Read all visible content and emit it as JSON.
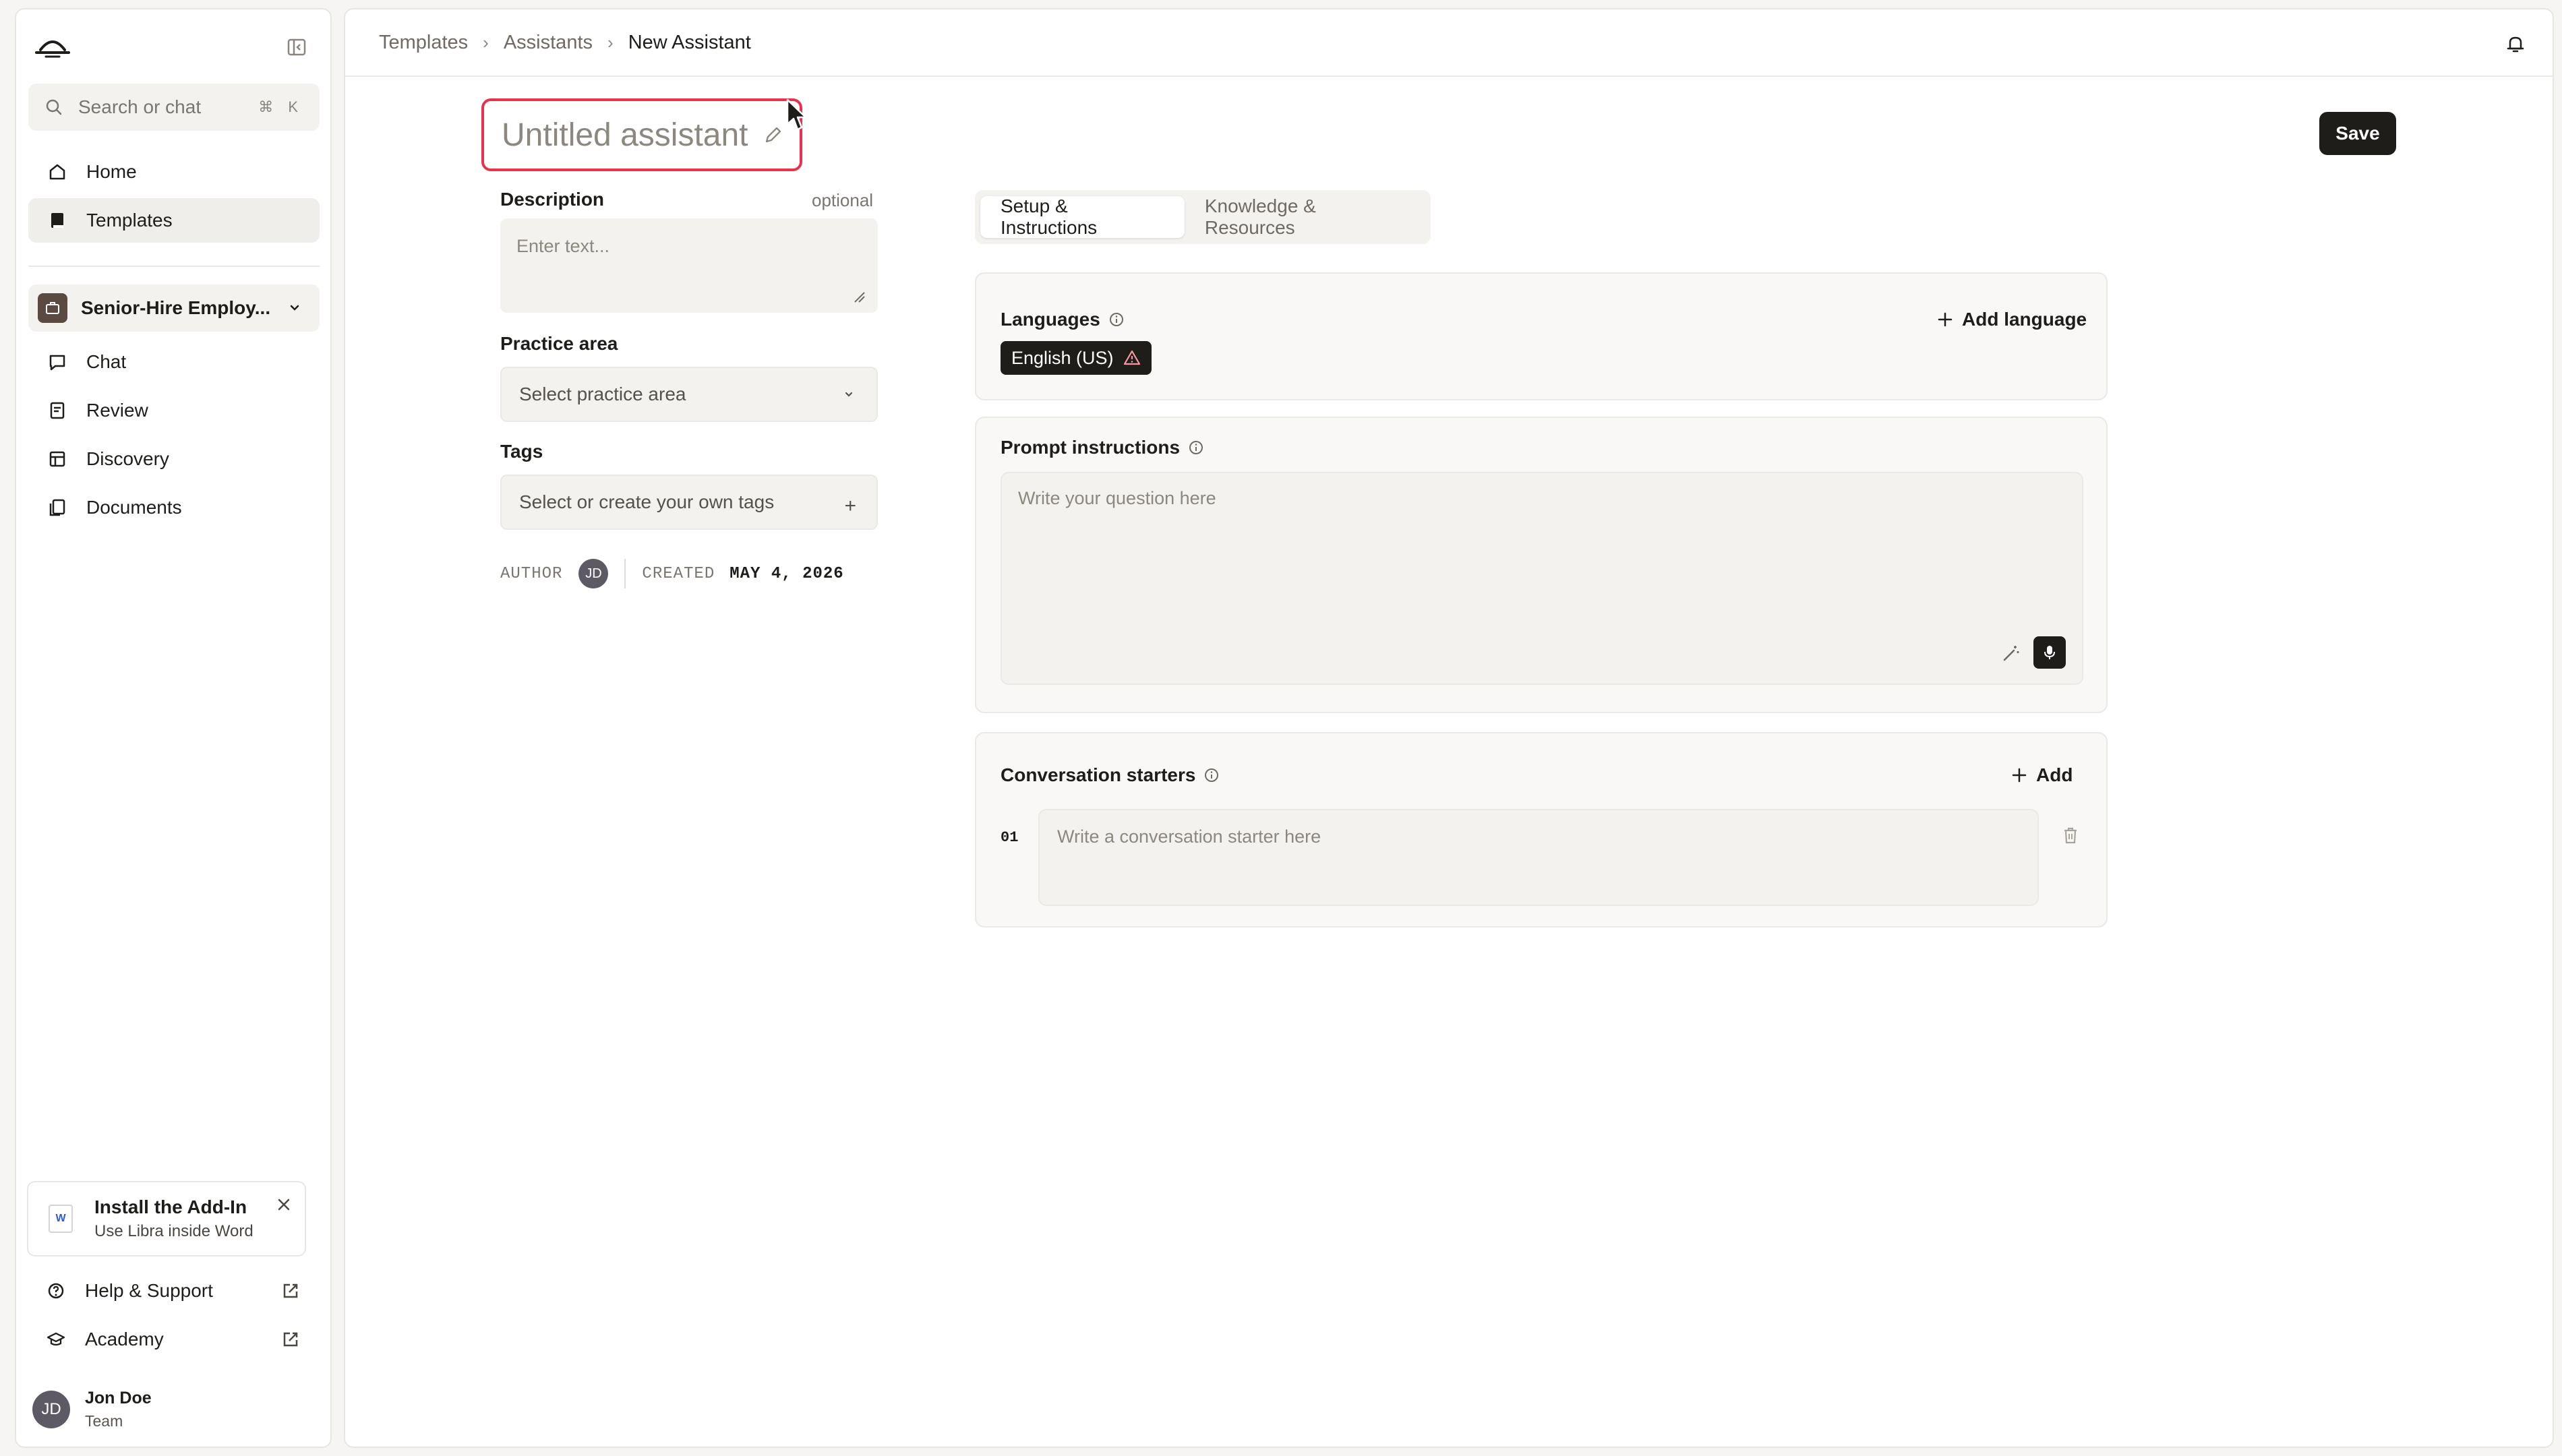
{
  "sidebar": {
    "search_placeholder": "Search or chat",
    "search_shortcut": "⌘ K",
    "nav_top": [
      {
        "label": "Home",
        "icon": "home-icon"
      },
      {
        "label": "Templates",
        "icon": "book-icon"
      }
    ],
    "workspace": {
      "name": "Senior-Hire Employ..."
    },
    "nav_workspace": [
      {
        "label": "Chat",
        "icon": "chat-icon"
      },
      {
        "label": "Review",
        "icon": "review-icon"
      },
      {
        "label": "Discovery",
        "icon": "table-icon"
      },
      {
        "label": "Documents",
        "icon": "documents-icon"
      }
    ],
    "addin": {
      "title": "Install the Add-In",
      "subtitle": "Use Libra inside Word",
      "badge": "W"
    },
    "nav_bottom": [
      {
        "label": "Help & Support",
        "icon": "help-icon"
      },
      {
        "label": "Academy",
        "icon": "academy-icon"
      }
    ],
    "user": {
      "initials": "JD",
      "name": "Jon Doe",
      "role": "Team"
    }
  },
  "breadcrumb": {
    "items": [
      "Templates",
      "Assistants",
      "New Assistant"
    ],
    "separator": "›"
  },
  "editor": {
    "title": "Untitled assistant",
    "save_label": "Save",
    "description": {
      "label": "Description",
      "optional": "optional",
      "placeholder": "Enter text..."
    },
    "practice_area": {
      "label": "Practice area",
      "placeholder": "Select practice area"
    },
    "tags": {
      "label": "Tags",
      "placeholder": "Select or create your own tags",
      "add": "+"
    },
    "meta": {
      "author_label": "AUTHOR",
      "author_initials": "JD",
      "created_label": "CREATED",
      "created_value": "MAY 4, 2026"
    }
  },
  "tabs": [
    {
      "label": "Setup & Instructions",
      "active": true
    },
    {
      "label": "Knowledge & Resources",
      "active": false
    }
  ],
  "languages": {
    "title": "Languages",
    "add_label": "Add language",
    "chips": [
      "English (US)"
    ]
  },
  "prompt": {
    "title": "Prompt instructions",
    "placeholder": "Write your question here"
  },
  "starters": {
    "title": "Conversation starters",
    "add_label": "Add",
    "items": [
      {
        "num": "01",
        "placeholder": "Write a conversation starter here"
      }
    ]
  },
  "colors": {
    "accent": "#1f1d1a",
    "focus_ring": "#e8314a",
    "workspace_avatar": "#5a4a42",
    "user_avatar": "#5d5a66"
  }
}
